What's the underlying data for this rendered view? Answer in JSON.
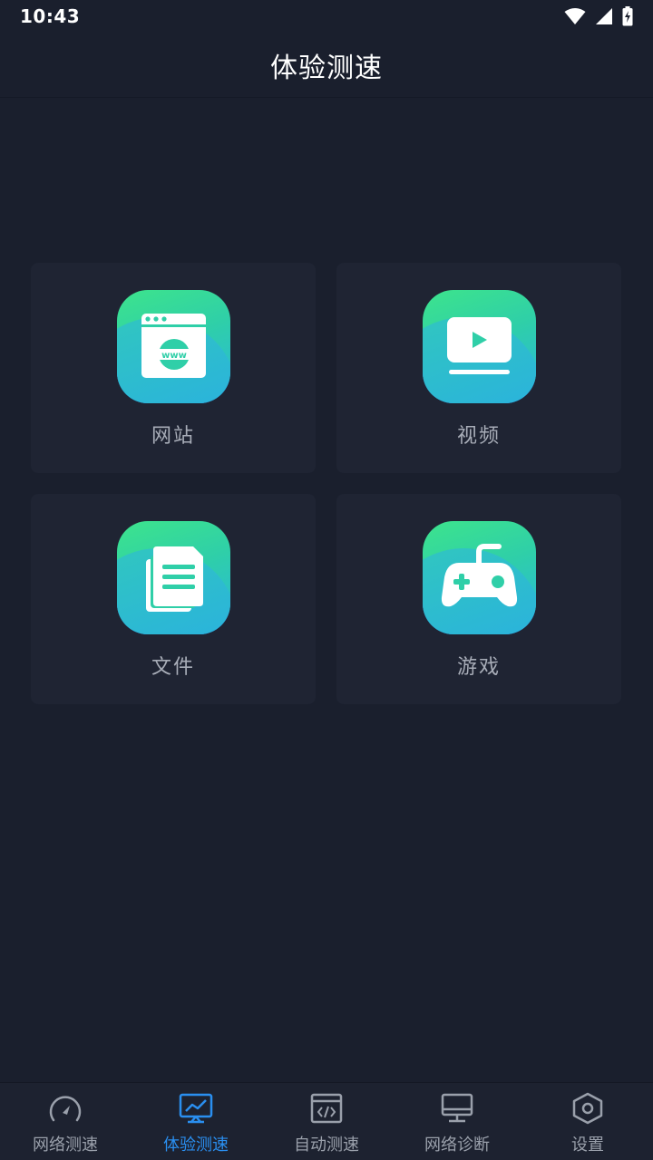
{
  "status_bar": {
    "time": "10:43"
  },
  "header": {
    "title": "体验测速"
  },
  "cards": [
    {
      "label": "网站",
      "icon": "website-icon"
    },
    {
      "label": "视频",
      "icon": "video-icon"
    },
    {
      "label": "文件",
      "icon": "file-icon"
    },
    {
      "label": "游戏",
      "icon": "game-controller-icon"
    }
  ],
  "bottom_nav": {
    "items": [
      {
        "label": "网络测速",
        "icon": "speedometer-icon",
        "active": false
      },
      {
        "label": "体验测速",
        "icon": "trend-chart-icon",
        "active": true
      },
      {
        "label": "自动测速",
        "icon": "code-window-icon",
        "active": false
      },
      {
        "label": "网络诊断",
        "icon": "monitor-icon",
        "active": false
      },
      {
        "label": "设置",
        "icon": "hexagon-settings-icon",
        "active": false
      }
    ]
  },
  "colors": {
    "background": "#1a1f2d",
    "card": "#1f2433",
    "accent": "#2a8ff0",
    "tile_gradient_start": "#3de48c",
    "tile_gradient_end": "#28b6e0",
    "tile_wave": "#2f5cf6"
  }
}
